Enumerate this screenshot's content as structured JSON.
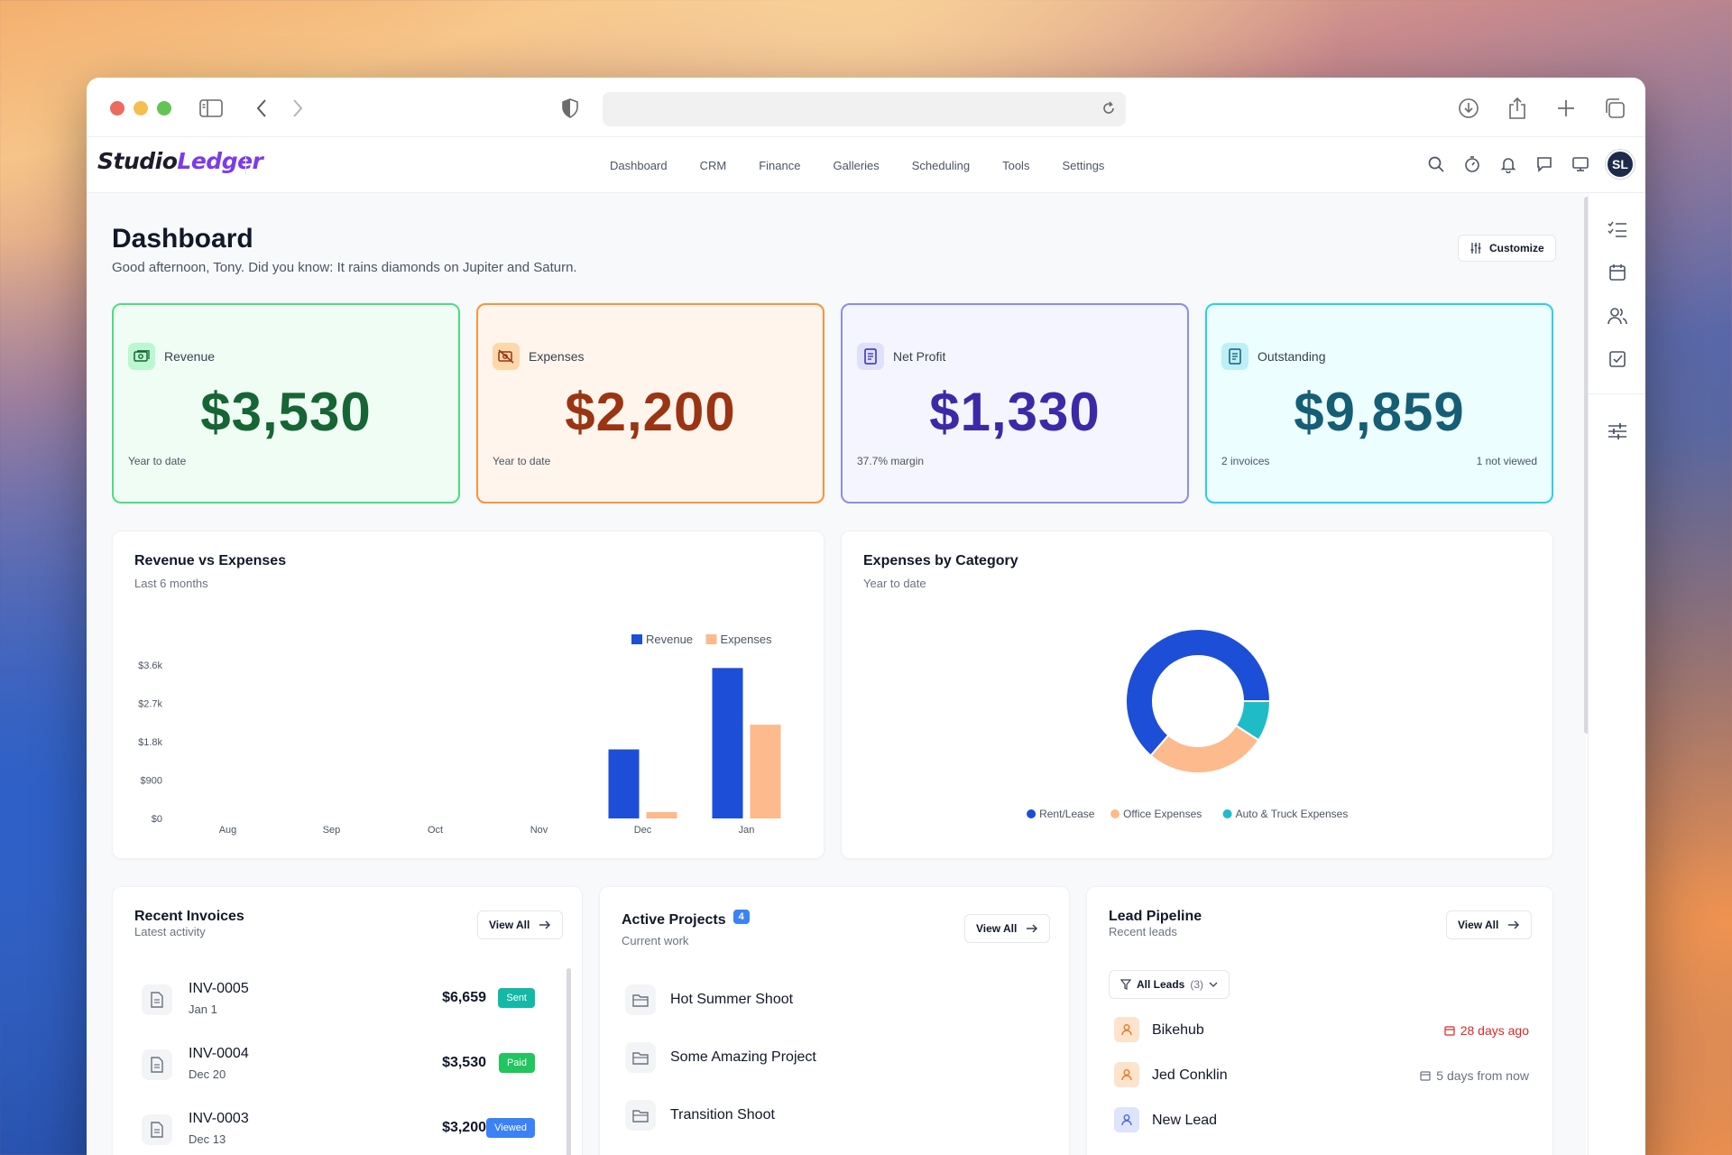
{
  "browser": {
    "traffic_lights": [
      "#ec6a5e",
      "#f4bf4f",
      "#61c554"
    ],
    "icons": [
      "sidebar-icon",
      "back-icon",
      "forward-icon",
      "shield-icon",
      "reload-icon",
      "download-icon",
      "share-icon",
      "new-tab-icon",
      "tabs-icon"
    ]
  },
  "app": {
    "logo_main": "Studio",
    "logo_accent": "Ledger",
    "nav": [
      "Dashboard",
      "CRM",
      "Finance",
      "Galleries",
      "Scheduling",
      "Tools",
      "Settings"
    ],
    "header_icons": [
      "search-icon",
      "timer-icon",
      "bell-icon",
      "chat-icon",
      "monitor-icon"
    ],
    "avatar": "SL"
  },
  "page": {
    "title": "Dashboard",
    "subtitle": "Good afternoon, Tony. Did you know: It rains diamonds on Jupiter and Saturn.",
    "customize_label": "Customize"
  },
  "stats": [
    {
      "label": "Revenue",
      "value": "$3,530",
      "foot": "Year to date",
      "foot_right": "",
      "color": "#166534",
      "border": "#4ade80",
      "bg": "#effdf4",
      "icon_bg": "#bbf7d0"
    },
    {
      "label": "Expenses",
      "value": "$2,200",
      "foot": "Year to date",
      "foot_right": "",
      "color": "#9a3412",
      "border": "#fb923c",
      "bg": "#fff5ec",
      "icon_bg": "#fed7aa"
    },
    {
      "label": "Net Profit",
      "value": "$1,330",
      "foot": "37.7% margin",
      "foot_right": "",
      "color": "#3b2aa8",
      "border": "#8b8cf0",
      "bg": "#f5f5ff",
      "icon_bg": "#dfe0fb"
    },
    {
      "label": "Outstanding",
      "value": "$9,859",
      "foot": "2 invoices",
      "foot_right": "1 not viewed",
      "color": "#155e75",
      "border": "#22d3ee",
      "bg": "#ecfeff",
      "icon_bg": "#bdeff6"
    }
  ],
  "revenue_chart": {
    "title": "Revenue vs Expenses",
    "subtitle": "Last 6 months"
  },
  "expense_chart": {
    "title": "Expenses by Category",
    "subtitle": "Year to date"
  },
  "chart_data": [
    {
      "type": "bar",
      "title": "Revenue vs Expenses",
      "subtitle": "Last 6 months",
      "categories": [
        "Aug",
        "Sep",
        "Oct",
        "Nov",
        "Dec",
        "Jan"
      ],
      "series": [
        {
          "name": "Revenue",
          "values": [
            0,
            0,
            0,
            0,
            1620,
            3530
          ],
          "color": "#1d4ed8"
        },
        {
          "name": "Expenses",
          "values": [
            0,
            0,
            0,
            0,
            150,
            2200
          ],
          "color": "#fdba8c"
        }
      ],
      "y_ticks": [
        "$0",
        "$900",
        "$1.8k",
        "$2.7k",
        "$3.6k"
      ],
      "ylim": [
        0,
        3600
      ],
      "legend": "top-right"
    },
    {
      "type": "pie",
      "title": "Expenses by Category",
      "subtitle": "Year to date",
      "categories": [
        "Rent/Lease",
        "Office Expenses",
        "Auto & Truck Expenses"
      ],
      "values": [
        1400,
        600,
        200
      ],
      "colors": [
        "#1d4ed8",
        "#fdba8c",
        "#1fbcc8"
      ],
      "legend": "bottom"
    }
  ],
  "invoices": {
    "title": "Recent Invoices",
    "subtitle": "Latest activity",
    "view_all": "View All",
    "items": [
      {
        "number": "INV-0005",
        "date": "Jan 1",
        "amount": "$6,659",
        "status": "Sent",
        "status_color": "#14b8a6"
      },
      {
        "number": "INV-0004",
        "date": "Dec 20",
        "amount": "$3,530",
        "status": "Paid",
        "status_color": "#22c55e"
      },
      {
        "number": "INV-0003",
        "date": "Dec 13",
        "amount": "$3,200",
        "status": "Viewed",
        "status_color": "#3b82f6"
      }
    ]
  },
  "projects": {
    "title": "Active Projects",
    "count": "4",
    "subtitle": "Current work",
    "view_all": "View All",
    "items": [
      "Hot Summer Shoot",
      "Some Amazing Project",
      "Transition Shoot"
    ]
  },
  "leads": {
    "title": "Lead Pipeline",
    "subtitle": "Recent leads",
    "view_all": "View All",
    "filter_label": "All Leads",
    "filter_count": "(3)",
    "items": [
      {
        "name": "Bikehub",
        "when": "28 days ago",
        "when_color": "#dc2626",
        "icon_bg": "#fde3cc",
        "icon_color": "#ea7a2a"
      },
      {
        "name": "Jed Conklin",
        "when": "5 days from now",
        "when_color": "#6b7280",
        "icon_bg": "#fde3cc",
        "icon_color": "#ea7a2a"
      },
      {
        "name": "New Lead",
        "when": "",
        "when_color": "#6b7280",
        "icon_bg": "#dde4fb",
        "icon_color": "#4f6bd8"
      }
    ]
  },
  "rightbar_icons": [
    "checklist-icon",
    "calendar-icon",
    "users-icon",
    "checkbox-icon",
    "sliders-icon"
  ]
}
